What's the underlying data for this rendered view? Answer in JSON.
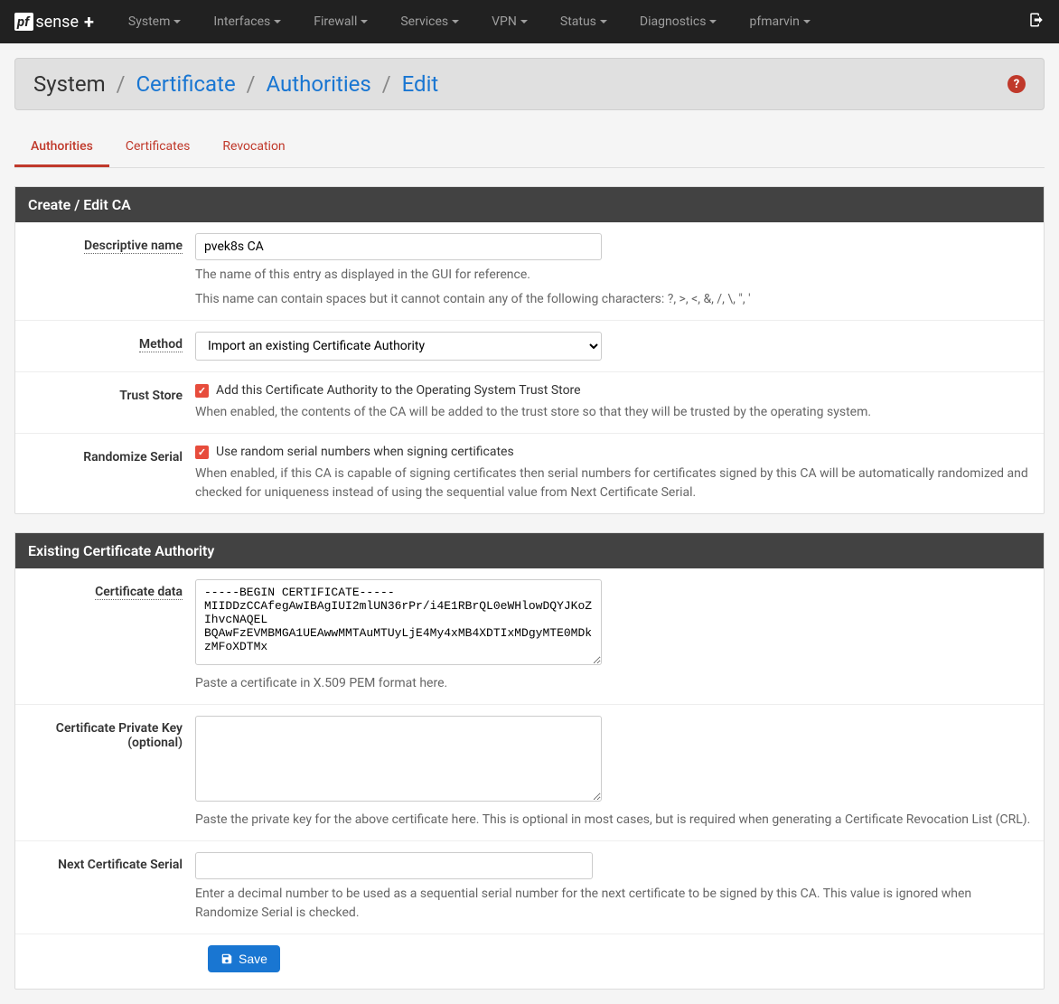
{
  "nav": {
    "logo_prefix": "pf",
    "logo_main": "sense",
    "logo_suffix": "+",
    "items": [
      "System",
      "Interfaces",
      "Firewall",
      "Services",
      "VPN",
      "Status",
      "Diagnostics",
      "pfmarvin"
    ]
  },
  "breadcrumb": {
    "root": "System",
    "parts": [
      "Certificate",
      "Authorities",
      "Edit"
    ]
  },
  "tabs": [
    "Authorities",
    "Certificates",
    "Revocation"
  ],
  "panel1_title": "Create / Edit CA",
  "panel2_title": "Existing Certificate Authority",
  "fields": {
    "desc_label": "Descriptive name",
    "desc_value": "pvek8s CA",
    "desc_help1": "The name of this entry as displayed in the GUI for reference.",
    "desc_help2": "This name can contain spaces but it cannot contain any of the following characters: ?, >, <, &, /, \\, \", '",
    "method_label": "Method",
    "method_value": "Import an existing Certificate Authority",
    "trust_label": "Trust Store",
    "trust_check_label": "Add this Certificate Authority to the Operating System Trust Store",
    "trust_help": "When enabled, the contents of the CA will be added to the trust store so that they will be trusted by the operating system.",
    "rand_label": "Randomize Serial",
    "rand_check_label": "Use random serial numbers when signing certificates",
    "rand_help": "When enabled, if this CA is capable of signing certificates then serial numbers for certificates signed by this CA will be automatically randomized and checked for uniqueness instead of using the sequential value from Next Certificate Serial.",
    "cert_label": "Certificate data",
    "cert_value": "-----BEGIN CERTIFICATE-----\nMIIDDzCCAfegAwIBAgIUI2mlUN36rPr/i4E1RBrQL0eWHlowDQYJKoZIhvcNAQEL\nBQAwFzEVMBMGA1UEAwwMMTAuMTUyLjE4My4xMB4XDTIxMDgyMTE0MDkzMFoXDTMx",
    "cert_help": "Paste a certificate in X.509 PEM format here.",
    "key_label": "Certificate Private Key (optional)",
    "key_value": "",
    "key_help": "Paste the private key for the above certificate here. This is optional in most cases, but is required when generating a Certificate Revocation List (CRL).",
    "serial_label": "Next Certificate Serial",
    "serial_value": "",
    "serial_help": "Enter a decimal number to be used as a sequential serial number for the next certificate to be signed by this CA. This value is ignored when Randomize Serial is checked."
  },
  "save_label": "Save"
}
